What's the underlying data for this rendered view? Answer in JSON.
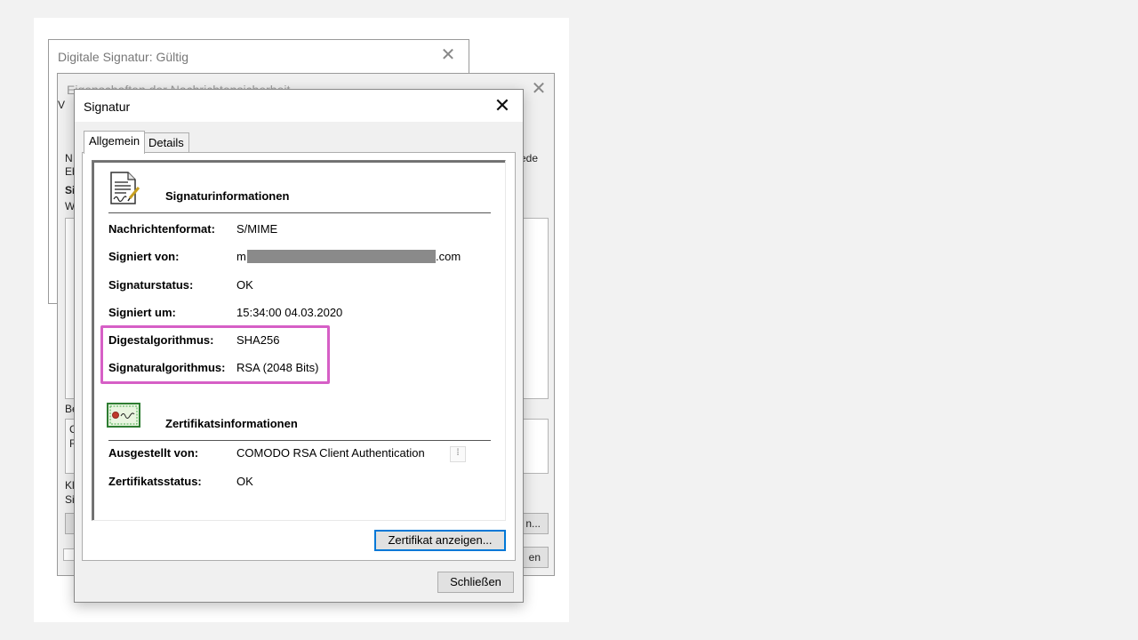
{
  "back_window": {
    "title": "Digitale Signatur: Gültig",
    "close": "✕"
  },
  "mid_window": {
    "title": "Eigenschaften der Nachrichtensicherheit",
    "close": "✕",
    "fragments": {
      "v": "V",
      "n": "N",
      "eb": "Eb",
      "si": "Si",
      "w": "W",
      "ede": "ede",
      "be": "Be",
      "c": "C",
      "r": "R",
      "kl": "Kl",
      "si2": "Si",
      "n_btn": "n...",
      "en_btn": "en"
    }
  },
  "dialog": {
    "title": "Signatur",
    "close": "✕",
    "tabs": [
      "Allgemein",
      "Details"
    ],
    "signature_section": {
      "title": "Signaturinformationen",
      "icon": "document-signature-icon",
      "rows": [
        {
          "label": "Nachrichtenformat:",
          "value": "S/MIME"
        },
        {
          "label": "Signiert von:",
          "value_prefix": "m",
          "value_suffix": ".com"
        },
        {
          "label": "Signaturstatus:",
          "value": "OK"
        },
        {
          "label": "Signiert um:",
          "value": "15:34:00 04.03.2020"
        },
        {
          "label": "Digestalgorithmus:",
          "value": "SHA256"
        },
        {
          "label": "Signaturalgorithmus:",
          "value": "RSA (2048 Bits)"
        }
      ]
    },
    "certificate_section": {
      "title": "Zertifikatsinformationen",
      "icon": "certificate-icon",
      "rows": [
        {
          "label": "Ausgestellt von:",
          "value": "COMODO RSA Client Authentication"
        },
        {
          "label": "Zertifikatsstatus:",
          "value": "OK"
        }
      ]
    },
    "view_cert_button": "Zertifikat anzeigen...",
    "close_button": "Schließen"
  },
  "colors": {
    "highlight": "#d65fc6",
    "focus": "#0078d7"
  }
}
